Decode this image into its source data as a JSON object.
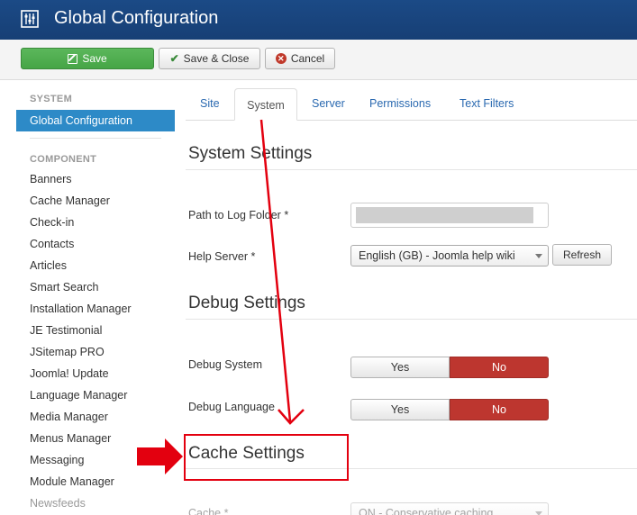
{
  "header": {
    "title": "Global Configuration",
    "icon": "config-icon"
  },
  "toolbar": {
    "save_label": "Save",
    "save_close_label": "Save & Close",
    "cancel_label": "Cancel"
  },
  "sidebar": {
    "system_heading": "SYSTEM",
    "active_item": "Global Configuration",
    "component_heading": "COMPONENT",
    "items": [
      "Banners",
      "Cache Manager",
      "Check-in",
      "Contacts",
      "Articles",
      "Smart Search",
      "Installation Manager",
      "JE Testimonial",
      "JSitemap PRO",
      "Joomla! Update",
      "Language Manager",
      "Media Manager",
      "Menus Manager",
      "Messaging",
      "Module Manager",
      "Newsfeeds"
    ]
  },
  "tabs": {
    "site": "Site",
    "system": "System",
    "server": "Server",
    "permissions": "Permissions",
    "text_filters": "Text Filters"
  },
  "system_settings": {
    "title": "System Settings",
    "log_path_label": "Path to Log Folder *",
    "help_server_label": "Help Server *",
    "help_server_value": "English (GB) - Joomla help wiki",
    "refresh_label": "Refresh"
  },
  "debug_settings": {
    "title": "Debug Settings",
    "debug_system_label": "Debug System",
    "debug_language_label": "Debug Language",
    "yes": "Yes",
    "no": "No"
  },
  "cache_settings": {
    "title": "Cache Settings",
    "cache_label": "Cache *",
    "cache_value": "ON - Conservative caching"
  },
  "colors": {
    "header_bg": "#1b4a86",
    "save_green": "#46a546",
    "active_blue": "#2d8ac7",
    "no_red": "#bd362f",
    "annotation_red": "#e3000f"
  }
}
